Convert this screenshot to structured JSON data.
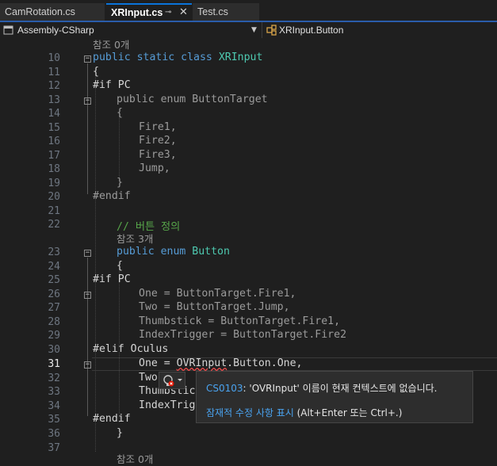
{
  "tabs": [
    {
      "label": "CamRotation.cs"
    },
    {
      "label": "XRInput.cs",
      "pin_icon": "pin-icon",
      "close_icon": "close-icon"
    },
    {
      "label": "Test.cs"
    }
  ],
  "nav": {
    "project": "Assembly-CSharp",
    "member": "XRInput.Button"
  },
  "code_lens": {
    "ref0": "참조 0개",
    "ref3": "참조 3개"
  },
  "code": {
    "l10": {
      "kw": "public static class",
      "name": "XRInput"
    },
    "l11": "{",
    "l12": {
      "directive": "#if",
      "sym": "PC"
    },
    "l13": {
      "kw": "public enum",
      "name": "ButtonTarget"
    },
    "l14": "{",
    "l15": "Fire1,",
    "l16": "Fire2,",
    "l17": "Fire3,",
    "l18": "Jump,",
    "l19": "}",
    "l20": "#endif",
    "l22": "// 버튼 정의",
    "l23": {
      "kw": "public enum",
      "name": "Button"
    },
    "l24": "{",
    "l25": {
      "directive": "#if",
      "sym": "PC"
    },
    "l26": "One = ButtonTarget.Fire1,",
    "l27": "Two = ButtonTarget.Jump,",
    "l28": "Thumbstick = ButtonTarget.Fire1,",
    "l29": "IndexTrigger = ButtonTarget.Fire2",
    "l30": "#elif Oculus",
    "l31": {
      "pre": "One = ",
      "err": "OVRInput",
      "post": ".Button.One,"
    },
    "l32": "Two",
    "l33": "Thumbstick",
    "l34": "IndexTrigger",
    "l35": "#endif",
    "l36": "}"
  },
  "line_numbers": [
    "10",
    "11",
    "12",
    "13",
    "14",
    "15",
    "16",
    "17",
    "18",
    "19",
    "20",
    "21",
    "22",
    "23",
    "24",
    "25",
    "26",
    "27",
    "28",
    "29",
    "30",
    "31",
    "32",
    "33",
    "34",
    "35",
    "36",
    "37"
  ],
  "current_line": "31",
  "tooltip": {
    "code": "CS0103",
    "message": ": 'OVRInput' 이름이 현재 컨텍스트에 없습니다.",
    "fix_link": "잠재적 수정 사항 표시",
    "fix_shortcut": " (Alt+Enter 또는 Ctrl+.)"
  },
  "icons": {
    "bulb": "error-lightbulb-icon",
    "class": "class-icon",
    "project": "csharp-project-icon"
  },
  "colors": {
    "accent": "#0a74da",
    "error": "#f14c4c",
    "keyword": "#569cd6",
    "type": "#4ec9b0",
    "comment": "#57a64a"
  }
}
